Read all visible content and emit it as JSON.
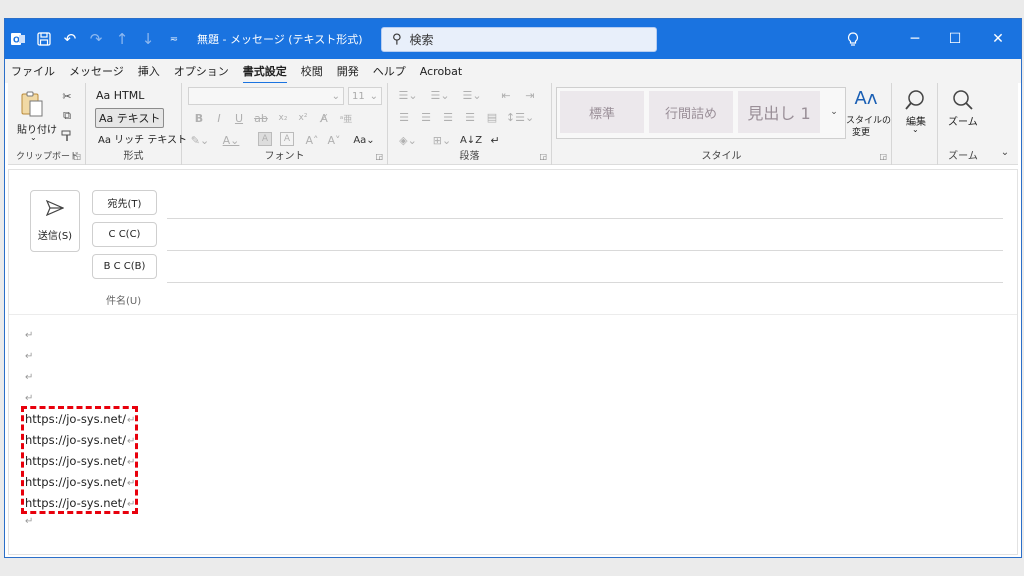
{
  "titlebar": {
    "title": "無題 - メッセージ (テキスト形式)",
    "search_placeholder": "検索"
  },
  "menu": [
    "ファイル",
    "メッセージ",
    "挿入",
    "オプション",
    "書式設定",
    "校閲",
    "開発",
    "ヘルプ",
    "Acrobat"
  ],
  "active_menu": "書式設定",
  "ribbon": {
    "clipboard": {
      "label": "クリップボード",
      "paste": "貼り付け"
    },
    "format": {
      "label": "形式",
      "html": "Aa HTML",
      "text": "Aa テキスト",
      "rich": "Aa リッチ テキスト"
    },
    "font": {
      "label": "フォント",
      "size": "11"
    },
    "paragraph": {
      "label": "段落"
    },
    "styles": {
      "label": "スタイル",
      "tile1": "標準",
      "tile2": "行間詰め",
      "tile3": "見出し 1",
      "change": "スタイルの",
      "change2": "変更"
    },
    "edit": {
      "label": "編集"
    },
    "zoom": {
      "label": "ズーム",
      "button": "ズーム"
    }
  },
  "compose": {
    "send": "送信(S)",
    "to": "宛先(T)",
    "cc": "C C(C)",
    "bcc": "B C C(B)",
    "subject": "件名(U)",
    "return_mark": "↵",
    "urls": [
      "https://jo-sys.net/",
      "https://jo-sys.net/",
      "https://jo-sys.net/",
      "https://jo-sys.net/",
      "https://jo-sys.net/"
    ]
  },
  "colors": {
    "accent": "#1a73e0",
    "highlight": "#e8000c"
  }
}
